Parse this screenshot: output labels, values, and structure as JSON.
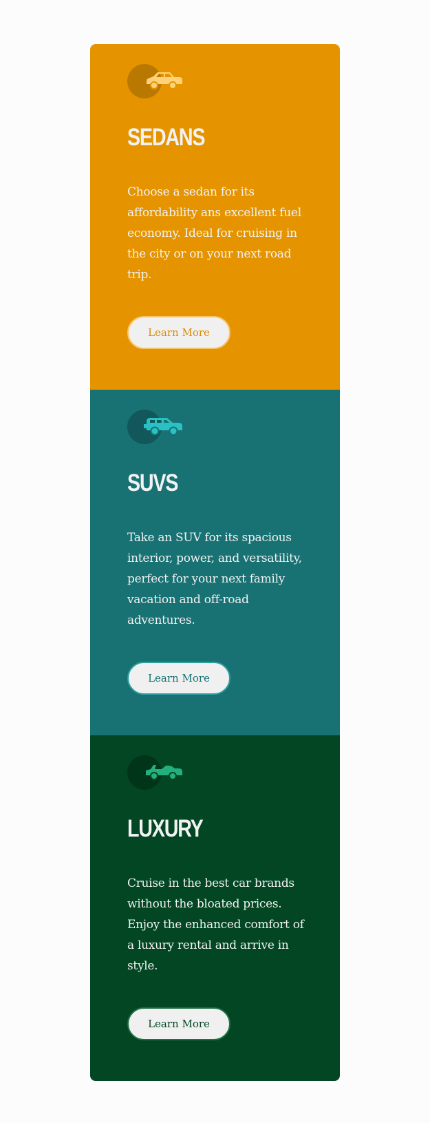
{
  "colors": {
    "sedans": "#e59400",
    "suvs": "#187173",
    "luxury": "#024623",
    "sedans_icon": "#ffd27a",
    "suvs_icon": "#2ac0c4",
    "luxury_icon": "#23b07e"
  },
  "cards": [
    {
      "icon": "sedan-car-icon",
      "title": "Sedans",
      "description": "Choose a sedan for its affordability ans excellent fuel economy. Ideal for cruising in the city or on your next road trip.",
      "button_label": "Learn More"
    },
    {
      "icon": "suv-car-icon",
      "title": "SUVs",
      "description": "Take an SUV for its spacious interior, power, and versatility, perfect for your next family vacation and off-road adventures.",
      "button_label": "Learn More"
    },
    {
      "icon": "luxury-car-icon",
      "title": "Luxury",
      "description": "Cruise in the best car brands without the bloated prices. Enjoy the enhanced comfort of a luxury rental and arrive in style.",
      "button_label": "Learn More"
    }
  ]
}
